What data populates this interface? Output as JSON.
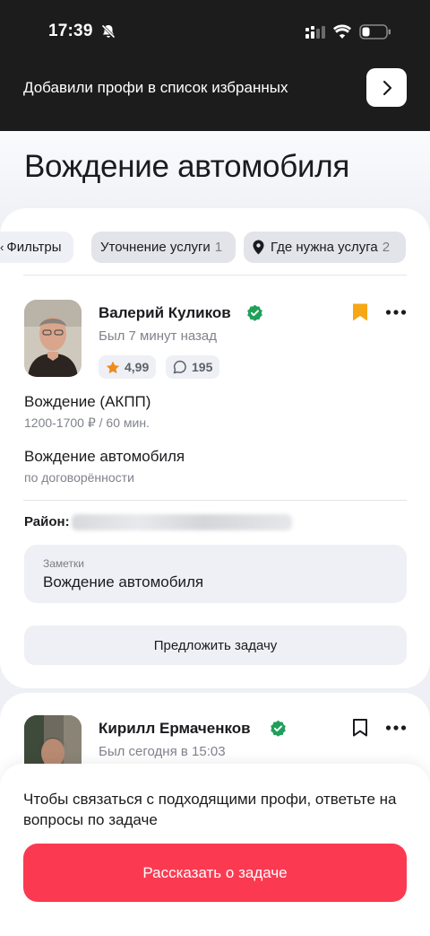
{
  "status_bar": {
    "time": "17:39"
  },
  "toast": {
    "text": "Добавили профи в список избранных"
  },
  "page": {
    "title": "Вождение автомобиля"
  },
  "filters": {
    "filters_label": "Фильтры",
    "service_label": "Уточнение услуги",
    "service_count": "1",
    "where_label": "Где нужна услуга",
    "where_count": "2"
  },
  "pros": [
    {
      "name": "Валерий Куликов",
      "last_seen": "Был 7 минут назад",
      "rating": "4,99",
      "reviews": "195",
      "bookmarked": true,
      "services": [
        {
          "title": "Вождение (АКПП)",
          "price": "1200-1700 ₽ / 60 мин."
        },
        {
          "title": "Вождение автомобиля",
          "price": "по договорённости"
        }
      ],
      "region_label": "Район:",
      "notes_label": "Заметки",
      "notes_text": "Вождение автомобиля",
      "propose_label": "Предложить задачу"
    },
    {
      "name": "Кирилл Ермаченков",
      "last_seen": "Был сегодня в 15:03",
      "bookmarked": false
    }
  ],
  "sheet": {
    "text": "Чтобы связаться с подходящими профи, ответьте на вопросы по задаче",
    "cta_label": "Рассказать о задаче"
  },
  "colors": {
    "accent": "#fb3a52",
    "verified": "#1fa05a",
    "bookmark_active": "#f6a716",
    "rating_star": "#f08a1c",
    "topbar": "#1c1c1c"
  }
}
